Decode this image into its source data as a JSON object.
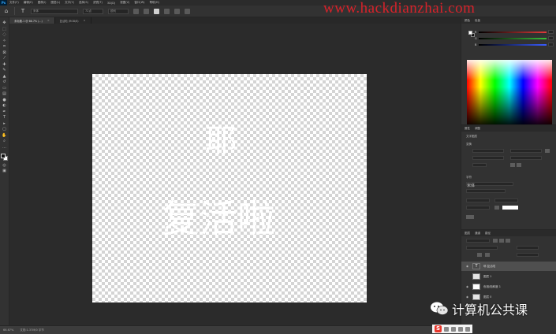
{
  "app": {
    "logo": "Ps"
  },
  "menu": [
    "文件(F)",
    "编辑(E)",
    "图像(I)",
    "图层(L)",
    "文字(Y)",
    "选择(S)",
    "滤镜(T)",
    "3D(D)",
    "视图(V)",
    "窗口(W)",
    "帮助(H)"
  ],
  "options": {
    "font_field": "宋体",
    "size_field": "72点",
    "aa_field": "锐利"
  },
  "watermark_url": "www.hackdianzhai.com",
  "tabs": [
    {
      "label": "未标题-1 @ 66.7% (...)",
      "active": true
    },
    {
      "label": "复活啦 (RGB/8)",
      "active": false
    }
  ],
  "canvas": {
    "line1": "耶",
    "line2": "复活啦"
  },
  "status": {
    "zoom": "66.67%",
    "doc": "文档:1.37M/0 字节"
  },
  "panels": {
    "color_tab": "颜色",
    "swatches_tab": "色板",
    "properties_tab": "属性",
    "adjust_tab": "调整",
    "layers_tab": "图层",
    "channels_tab": "通道",
    "paths_tab": "路径",
    "props_layer_type": "文字图层",
    "transform_label": "变换",
    "char_label": "字符",
    "font_value": "宋体",
    "accent_colors": {
      "red": "#e03a3a",
      "green": "#38c238",
      "blue": "#3a5cff"
    }
  },
  "layers": [
    {
      "name": "耶 复活啦",
      "type": "text",
      "selected": true
    },
    {
      "name": "图层 1",
      "type": "pixel",
      "selected": false
    },
    {
      "name": "色相/饱和度 1",
      "type": "adjust",
      "selected": false
    },
    {
      "name": "图层 0",
      "type": "pixel",
      "selected": false
    }
  ],
  "wechat_watermark": "计算机公共课"
}
